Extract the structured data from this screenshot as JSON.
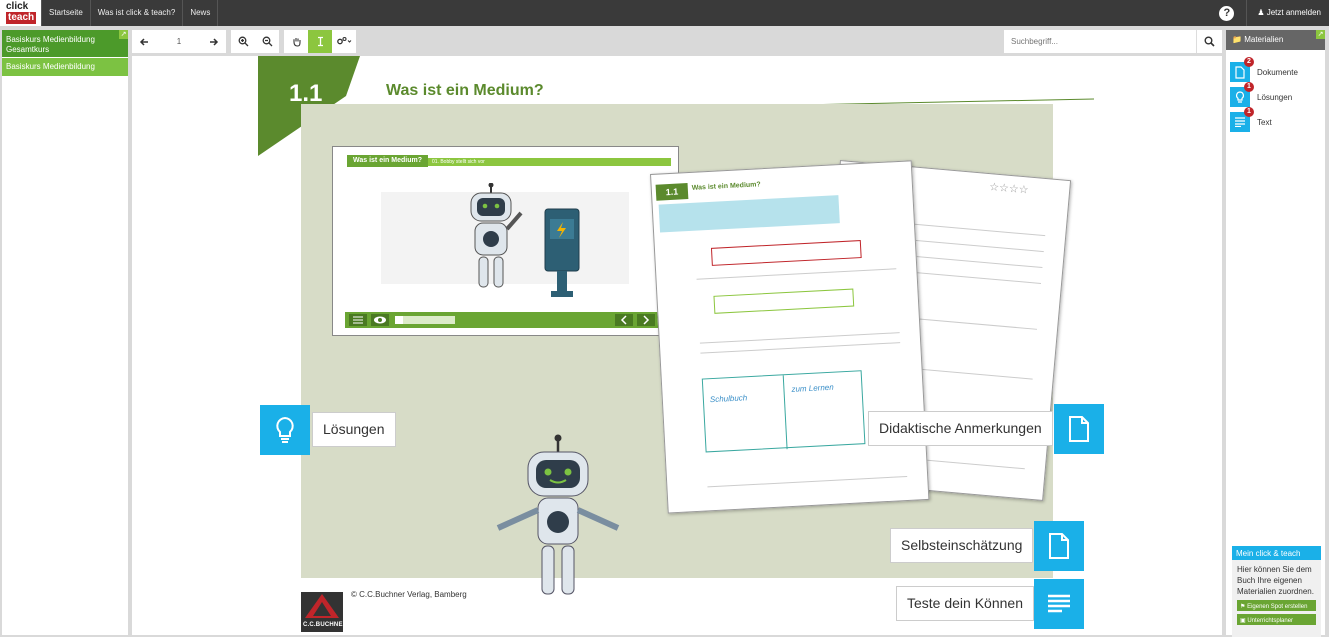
{
  "topbar": {
    "logo_line1": "click",
    "logo_line2": "teach",
    "nav": [
      "Startseite",
      "Was ist click & teach?",
      "News"
    ],
    "help": "?",
    "login": "Jetzt anmelden"
  },
  "leftbar": {
    "items": [
      "Basiskurs Medienbildung Gesamtkurs",
      "Basiskurs Medienbildung"
    ]
  },
  "toolbar": {
    "page": "1",
    "search_placeholder": "Suchbegriff..."
  },
  "page": {
    "chapter_number": "1.1",
    "chapter_title": "Was ist ein Medium?",
    "screen_title": "Was ist ein Medium?",
    "screen_bar": "01. Bobby stellt sich vor",
    "doc_title": "Was ist ein Medium?",
    "doc_num": "1.1",
    "copyright": "© C.C.Buchner Verlag, Bamberg",
    "publisher": "C.C.BUCHNER",
    "handwriting1": "Schulbuch",
    "handwriting2": "zum Lernen",
    "hotspots": {
      "loesungen": "Lösungen",
      "didaktik": "Didaktische Anmerkungen",
      "selbst": "Selbsteinschätzung",
      "teste": "Teste dein Können"
    }
  },
  "rightbar": {
    "header": "Materialien",
    "materials": [
      {
        "label": "Dokumente",
        "badge": "2",
        "icon": "document-icon"
      },
      {
        "label": "Lösungen",
        "badge": "1",
        "icon": "lightbulb-icon"
      },
      {
        "label": "Text",
        "badge": "1",
        "icon": "text-icon"
      }
    ],
    "mct_header": "Mein click & teach",
    "mct_text": "Hier können Sie dem Buch Ihre eigenen Materialien zuordnen.",
    "mct_btn1": "Eigenen Spot erstellen",
    "mct_btn2": "Unterrichtsplaner"
  },
  "colors": {
    "accent_blue": "#1ab0e8",
    "accent_green": "#8cc63f",
    "dark_green": "#4c9a2a",
    "topbar": "#3a3a3a"
  }
}
